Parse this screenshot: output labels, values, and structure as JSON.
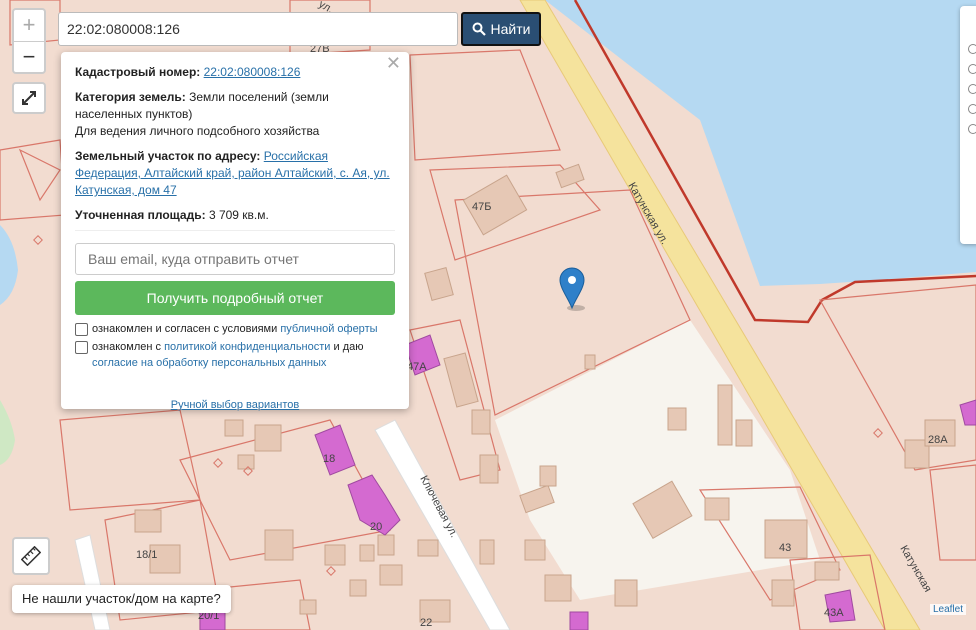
{
  "search": {
    "value": "22:02:080008:126",
    "button_label": "Найти"
  },
  "popup": {
    "cadastral_label": "Кадастровый номер:",
    "cadastral_value": "22:02:080008:126",
    "category_label": "Категория земель:",
    "category_value": "Земли поселений (земли населенных пунктов)",
    "usage": "Для ведения личного подсобного хозяйства",
    "address_label": "Земельный участок по адресу:",
    "address_value": "Российская Федерация, Алтайский край, район Алтайский, с. Ая, ул. Катунская, дом 47",
    "area_label": "Уточненная площадь:",
    "area_value": "3 709 кв.м.",
    "email_placeholder": "Ваш email, куда отправить отчет",
    "report_button": "Получить подробный отчет",
    "check1_text": "ознакомлен и согласен с условиями",
    "check1_link": "публичной оферты",
    "check2_text": "ознакомлен с",
    "check2_link": "политикой конфиденциальности",
    "check2_and": "и даю",
    "check2_link2": "согласие на обработку персональных данных",
    "manual_link": "Ручной выбор вариантов"
  },
  "map": {
    "street_labels": [
      "Катунская ул.",
      "Ключевая ул.",
      "Катунская"
    ],
    "house_labels": [
      "27В",
      "47Б",
      "47А",
      "18",
      "20",
      "18/1",
      "43",
      "28А",
      "43А",
      "22",
      "20/1"
    ],
    "top_street_fragment": "ул."
  },
  "controls": {
    "zoom_in": "+",
    "zoom_out": "−",
    "not_found": "Не нашли участок/дом на карте?"
  },
  "attribution": "Leaflet",
  "colors": {
    "water": "#b5d9f2",
    "road": "#f5e39d",
    "parcel_fill": "#f2dcd0",
    "parcel_border": "#d9776a",
    "accent": "#2a4e73",
    "green": "#5cb85c"
  }
}
